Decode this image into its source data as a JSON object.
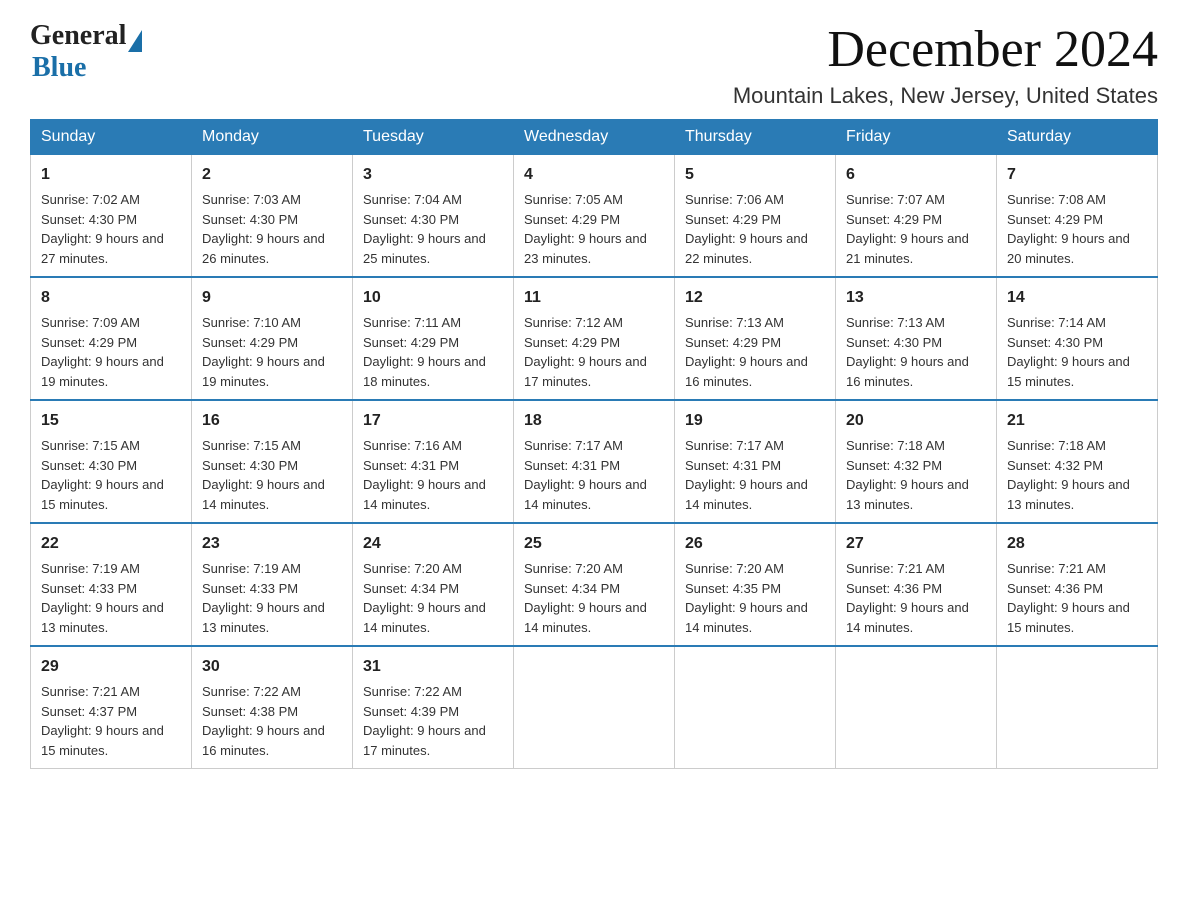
{
  "logo": {
    "general": "General",
    "blue": "Blue"
  },
  "title": "December 2024",
  "location": "Mountain Lakes, New Jersey, United States",
  "headers": [
    "Sunday",
    "Monday",
    "Tuesday",
    "Wednesday",
    "Thursday",
    "Friday",
    "Saturday"
  ],
  "weeks": [
    [
      {
        "day": "1",
        "sunrise": "7:02 AM",
        "sunset": "4:30 PM",
        "daylight": "9 hours and 27 minutes."
      },
      {
        "day": "2",
        "sunrise": "7:03 AM",
        "sunset": "4:30 PM",
        "daylight": "9 hours and 26 minutes."
      },
      {
        "day": "3",
        "sunrise": "7:04 AM",
        "sunset": "4:30 PM",
        "daylight": "9 hours and 25 minutes."
      },
      {
        "day": "4",
        "sunrise": "7:05 AM",
        "sunset": "4:29 PM",
        "daylight": "9 hours and 23 minutes."
      },
      {
        "day": "5",
        "sunrise": "7:06 AM",
        "sunset": "4:29 PM",
        "daylight": "9 hours and 22 minutes."
      },
      {
        "day": "6",
        "sunrise": "7:07 AM",
        "sunset": "4:29 PM",
        "daylight": "9 hours and 21 minutes."
      },
      {
        "day": "7",
        "sunrise": "7:08 AM",
        "sunset": "4:29 PM",
        "daylight": "9 hours and 20 minutes."
      }
    ],
    [
      {
        "day": "8",
        "sunrise": "7:09 AM",
        "sunset": "4:29 PM",
        "daylight": "9 hours and 19 minutes."
      },
      {
        "day": "9",
        "sunrise": "7:10 AM",
        "sunset": "4:29 PM",
        "daylight": "9 hours and 19 minutes."
      },
      {
        "day": "10",
        "sunrise": "7:11 AM",
        "sunset": "4:29 PM",
        "daylight": "9 hours and 18 minutes."
      },
      {
        "day": "11",
        "sunrise": "7:12 AM",
        "sunset": "4:29 PM",
        "daylight": "9 hours and 17 minutes."
      },
      {
        "day": "12",
        "sunrise": "7:13 AM",
        "sunset": "4:29 PM",
        "daylight": "9 hours and 16 minutes."
      },
      {
        "day": "13",
        "sunrise": "7:13 AM",
        "sunset": "4:30 PM",
        "daylight": "9 hours and 16 minutes."
      },
      {
        "day": "14",
        "sunrise": "7:14 AM",
        "sunset": "4:30 PM",
        "daylight": "9 hours and 15 minutes."
      }
    ],
    [
      {
        "day": "15",
        "sunrise": "7:15 AM",
        "sunset": "4:30 PM",
        "daylight": "9 hours and 15 minutes."
      },
      {
        "day": "16",
        "sunrise": "7:15 AM",
        "sunset": "4:30 PM",
        "daylight": "9 hours and 14 minutes."
      },
      {
        "day": "17",
        "sunrise": "7:16 AM",
        "sunset": "4:31 PM",
        "daylight": "9 hours and 14 minutes."
      },
      {
        "day": "18",
        "sunrise": "7:17 AM",
        "sunset": "4:31 PM",
        "daylight": "9 hours and 14 minutes."
      },
      {
        "day": "19",
        "sunrise": "7:17 AM",
        "sunset": "4:31 PM",
        "daylight": "9 hours and 14 minutes."
      },
      {
        "day": "20",
        "sunrise": "7:18 AM",
        "sunset": "4:32 PM",
        "daylight": "9 hours and 13 minutes."
      },
      {
        "day": "21",
        "sunrise": "7:18 AM",
        "sunset": "4:32 PM",
        "daylight": "9 hours and 13 minutes."
      }
    ],
    [
      {
        "day": "22",
        "sunrise": "7:19 AM",
        "sunset": "4:33 PM",
        "daylight": "9 hours and 13 minutes."
      },
      {
        "day": "23",
        "sunrise": "7:19 AM",
        "sunset": "4:33 PM",
        "daylight": "9 hours and 13 minutes."
      },
      {
        "day": "24",
        "sunrise": "7:20 AM",
        "sunset": "4:34 PM",
        "daylight": "9 hours and 14 minutes."
      },
      {
        "day": "25",
        "sunrise": "7:20 AM",
        "sunset": "4:34 PM",
        "daylight": "9 hours and 14 minutes."
      },
      {
        "day": "26",
        "sunrise": "7:20 AM",
        "sunset": "4:35 PM",
        "daylight": "9 hours and 14 minutes."
      },
      {
        "day": "27",
        "sunrise": "7:21 AM",
        "sunset": "4:36 PM",
        "daylight": "9 hours and 14 minutes."
      },
      {
        "day": "28",
        "sunrise": "7:21 AM",
        "sunset": "4:36 PM",
        "daylight": "9 hours and 15 minutes."
      }
    ],
    [
      {
        "day": "29",
        "sunrise": "7:21 AM",
        "sunset": "4:37 PM",
        "daylight": "9 hours and 15 minutes."
      },
      {
        "day": "30",
        "sunrise": "7:22 AM",
        "sunset": "4:38 PM",
        "daylight": "9 hours and 16 minutes."
      },
      {
        "day": "31",
        "sunrise": "7:22 AM",
        "sunset": "4:39 PM",
        "daylight": "9 hours and 17 minutes."
      },
      null,
      null,
      null,
      null
    ]
  ]
}
